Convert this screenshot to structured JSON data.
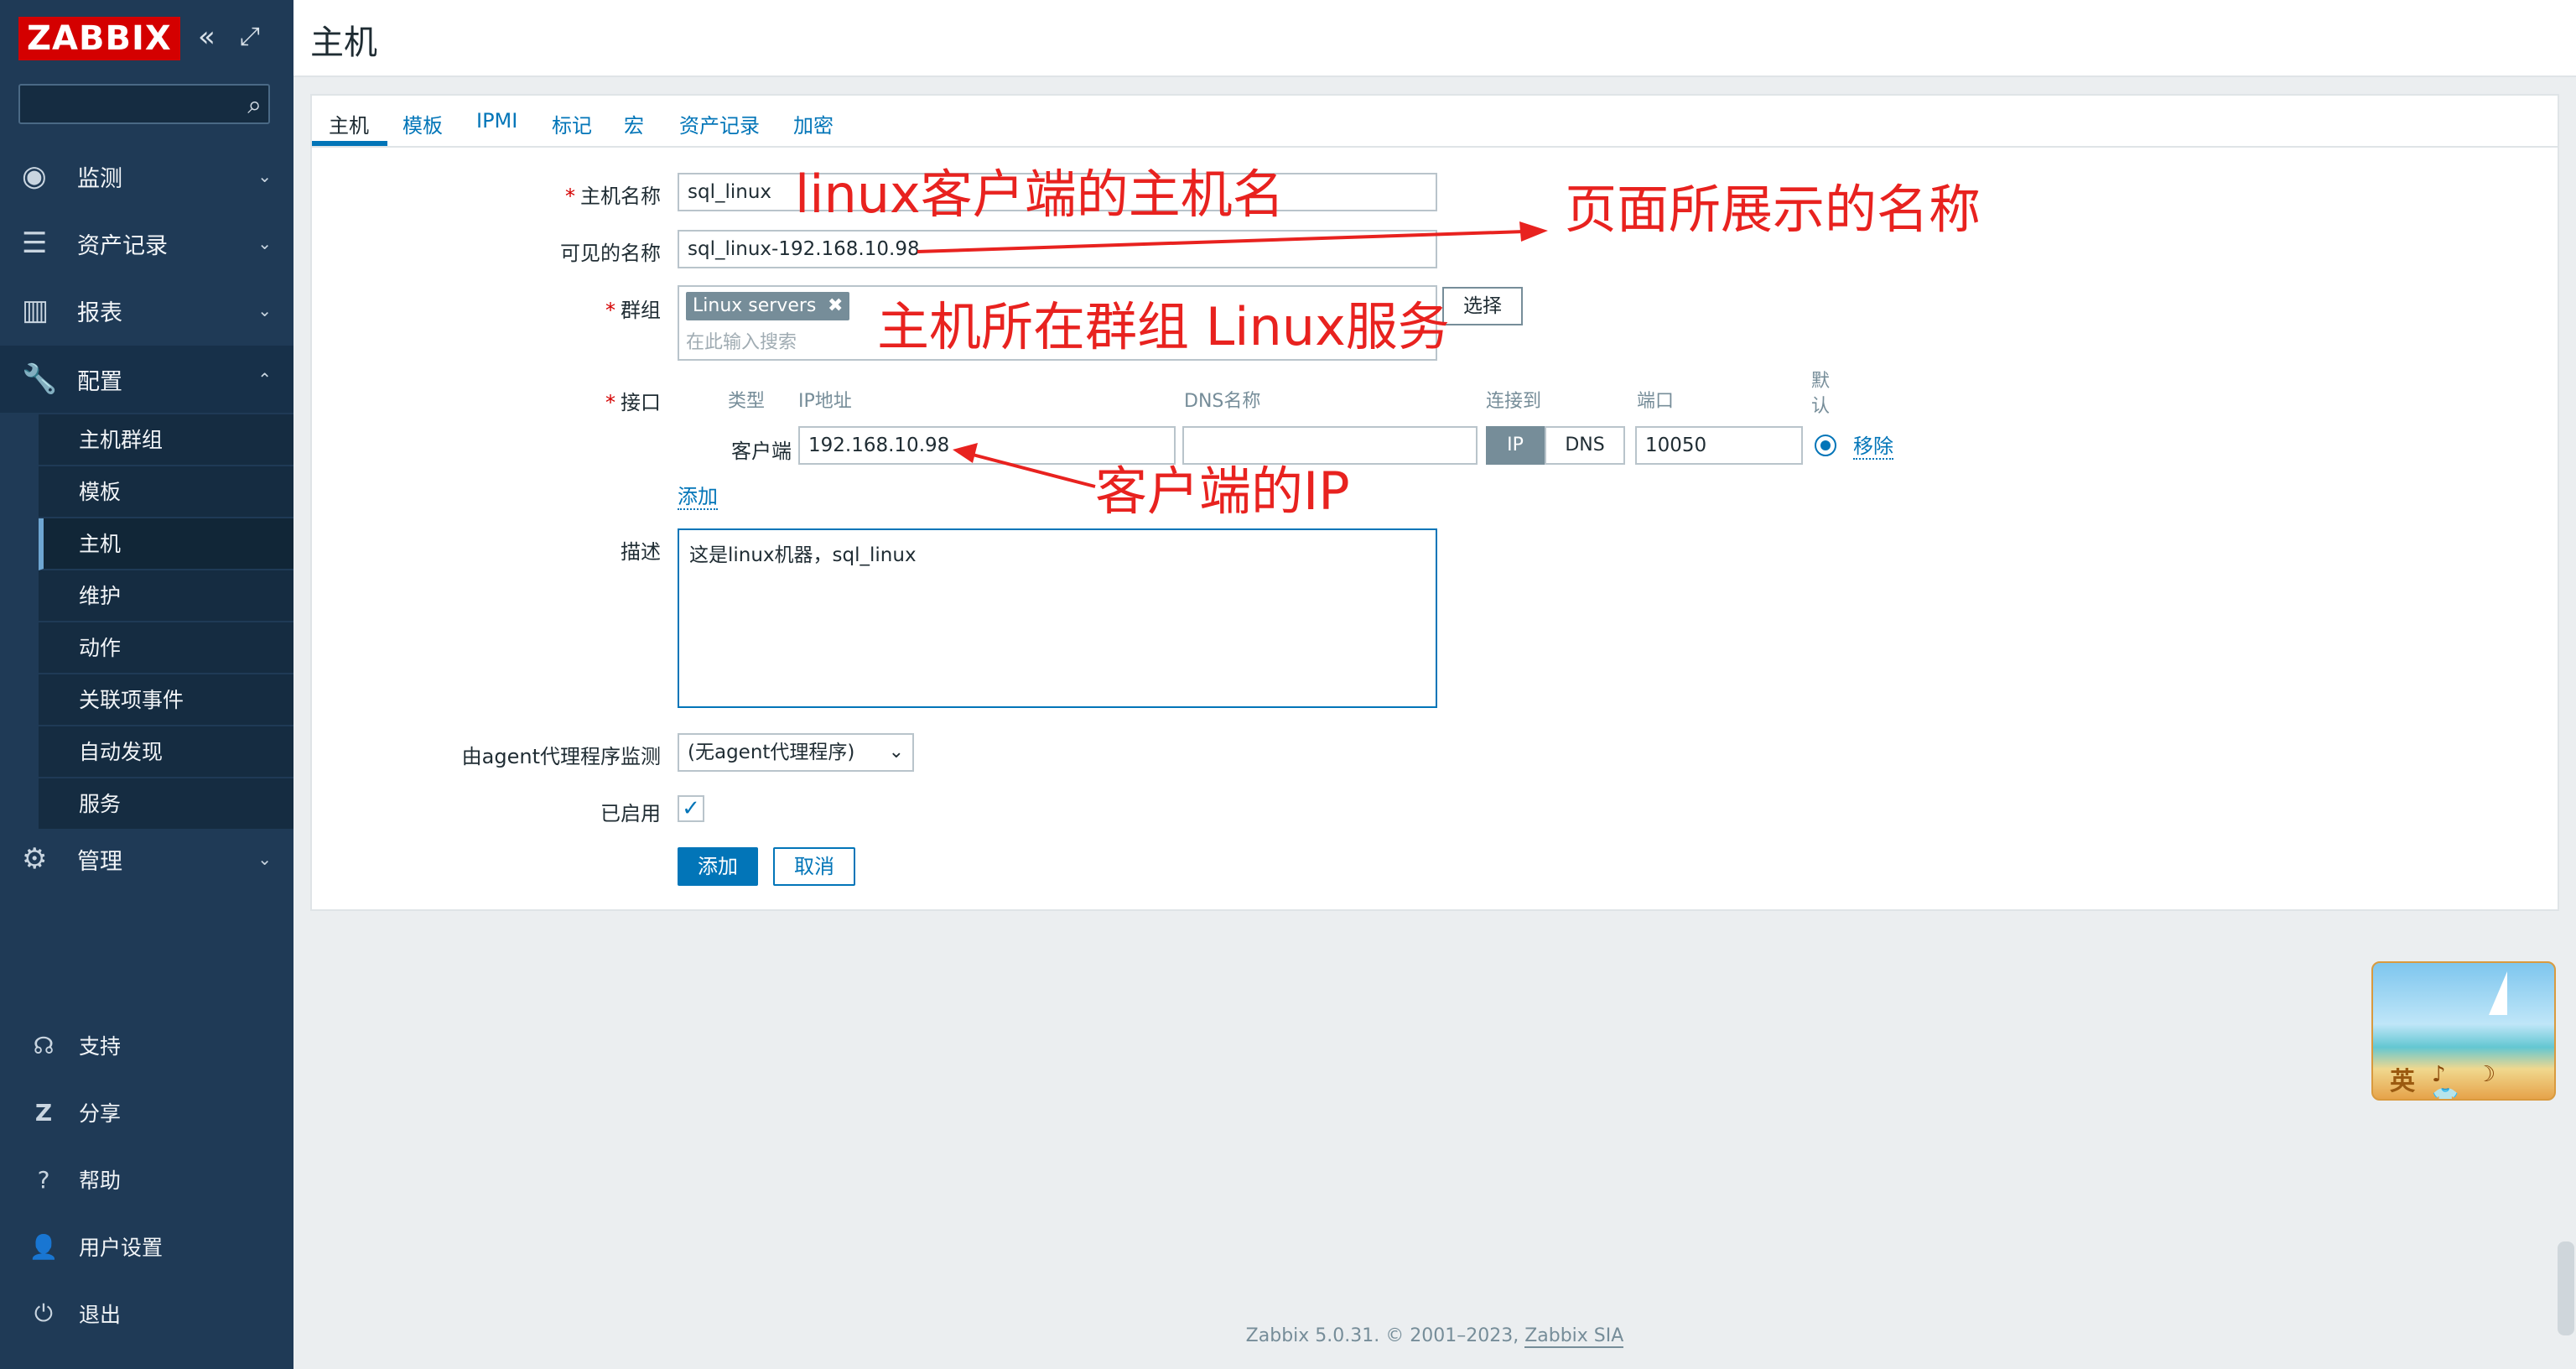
{
  "sidebar": {
    "logo": "ZABBIX",
    "collapse_icon": "«",
    "kiosk_icon": "⤢",
    "search_placeholder": "",
    "menu": [
      {
        "label": "监测",
        "icon": "eye-icon"
      },
      {
        "label": "资产记录",
        "icon": "list-icon"
      },
      {
        "label": "报表",
        "icon": "bar-chart-icon"
      },
      {
        "label": "配置",
        "icon": "wrench-icon",
        "open": true
      },
      {
        "label": "管理",
        "icon": "gear-icon"
      }
    ],
    "submenu": [
      "主机群组",
      "模板",
      "主机",
      "维护",
      "动作",
      "关联项事件",
      "自动发现",
      "服务"
    ],
    "active_submenu": "主机",
    "bottom": [
      {
        "label": "支持",
        "icon": "headset-icon"
      },
      {
        "label": "分享",
        "icon": "share-z-icon"
      },
      {
        "label": "帮助",
        "icon": "help-icon"
      },
      {
        "label": "用户设置",
        "icon": "user-icon"
      },
      {
        "label": "退出",
        "icon": "power-icon"
      }
    ]
  },
  "header": {
    "title": "主机"
  },
  "tabs": [
    {
      "label": "主机",
      "active": true
    },
    {
      "label": "模板"
    },
    {
      "label": "IPMI"
    },
    {
      "label": "标记"
    },
    {
      "label": "宏"
    },
    {
      "label": "资产记录"
    },
    {
      "label": "加密"
    }
  ],
  "form": {
    "host_name_label": "主机名称",
    "host_name_value": "sql_linux",
    "visible_name_label": "可见的名称",
    "visible_name_value": "sql_linux-192.168.10.98",
    "groups_label": "群组",
    "group_tag": "Linux servers",
    "group_tag_remove": "✖",
    "groups_placeholder": "在此输入搜索",
    "select_button": "选择",
    "interfaces_label": "接口",
    "iface_headers": {
      "type": "类型",
      "ip": "IP地址",
      "dns": "DNS名称",
      "connect": "连接到",
      "port": "端口",
      "default": "默认"
    },
    "iface_type": "客户端",
    "iface_ip": "192.168.10.98",
    "iface_dns": "",
    "connect_ip": "IP",
    "connect_dns": "DNS",
    "iface_port": "10050",
    "remove_link": "移除",
    "add_link": "添加",
    "description_label": "描述",
    "description_value": "这是linux机器，sql_linux",
    "proxy_label": "由agent代理程序监测",
    "proxy_value": "(无agent代理程序)",
    "enabled_label": "已启用",
    "enabled": true,
    "add_button": "添加",
    "cancel_button": "取消"
  },
  "annotations": {
    "host_name": "linux客户端的主机名",
    "visible_name": "页面所展示的名称",
    "group": "主机所在群组 Linux服务",
    "ip": "客户端的IP"
  },
  "widget": {
    "text": "英",
    "icons": "♪ ☽ 👕"
  },
  "footer": {
    "text": "Zabbix 5.0.31. © 2001–2023, ",
    "link": "Zabbix SIA"
  },
  "colors": {
    "sidebar": "#1f3a56",
    "accent": "#0275b8",
    "logo": "#d40000",
    "annotation": "#e8221f"
  }
}
